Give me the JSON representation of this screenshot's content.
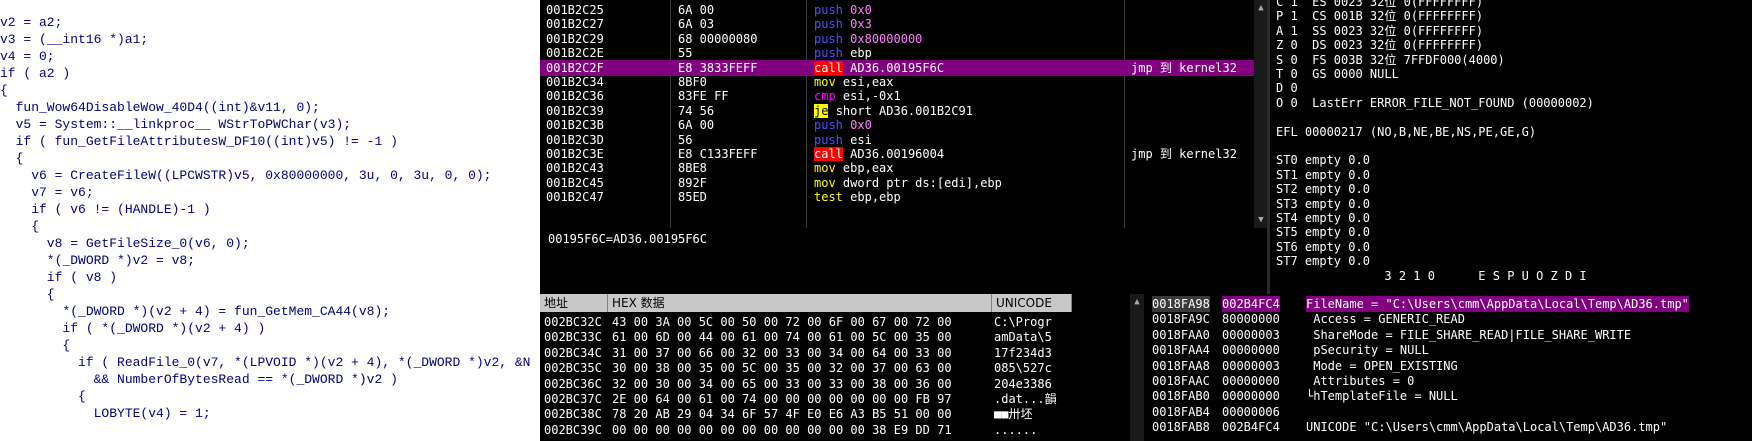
{
  "code": [
    "v2 = a2;",
    "v3 = (__int16 *)a1;",
    "v4 = 0;",
    "if ( a2 )",
    "{",
    "  fun_Wow64DisableWow_40D4((int)&v11, 0);",
    "  v5 = System::__linkproc__ WStrToPWChar(v3);",
    "  if ( fun_GetFileAttributesW_DF10((int)v5) != -1 )",
    "  {",
    "    v6 = CreateFileW((LPCWSTR)v5, 0x80000000, 3u, 0, 3u, 0, 0);",
    "    v7 = v6;",
    "    if ( v6 != (HANDLE)-1 )",
    "    {",
    "      v8 = GetFileSize_0(v6, 0);",
    "      *(_DWORD *)v2 = v8;",
    "      if ( v8 )",
    "      {",
    "        *(_DWORD *)(v2 + 4) = fun_GetMem_CA44(v8);",
    "        if ( *(_DWORD *)(v2 + 4) )",
    "        {",
    "          if ( ReadFile_0(v7, *(LPVOID *)(v2 + 4), *(_DWORD *)v2, &N",
    "            && NumberOfBytesRead == *(_DWORD *)v2 )",
    "          {",
    "            LOBYTE(v4) = 1;"
  ],
  "disasm": [
    {
      "addr": "001B2C25",
      "bytes": "6A 00",
      "mn": "push",
      "ops": "0x0",
      "cmt": ""
    },
    {
      "addr": "001B2C27",
      "bytes": "6A 03",
      "mn": "push",
      "ops": "0x3",
      "cmt": ""
    },
    {
      "addr": "001B2C29",
      "bytes": "68 00000080",
      "mn": "push",
      "ops": "0x80000000",
      "cmt": ""
    },
    {
      "addr": "001B2C2E",
      "bytes": "55",
      "mn": "push",
      "ops": "ebp",
      "cmt": ""
    },
    {
      "addr": "001B2C2F",
      "bytes": "E8 3833FEFF",
      "mn": "call",
      "ops": "AD36.00195F6C",
      "cmt": "jmp 到 kernel32"
    },
    {
      "addr": "001B2C34",
      "bytes": "8BF0",
      "mn": "mov",
      "ops": "esi,eax",
      "cmt": ""
    },
    {
      "addr": "001B2C36",
      "bytes": "83FE FF",
      "mn": "cmp",
      "ops": "esi,-0x1",
      "cmt": ""
    },
    {
      "addr": "001B2C39",
      "bytes": "74 56",
      "mn": "je",
      "ops": "short AD36.001B2C91",
      "cmt": ""
    },
    {
      "addr": "001B2C3B",
      "bytes": "6A 00",
      "mn": "push",
      "ops": "0x0",
      "cmt": ""
    },
    {
      "addr": "001B2C3D",
      "bytes": "56",
      "mn": "push",
      "ops": "esi",
      "cmt": ""
    },
    {
      "addr": "001B2C3E",
      "bytes": "E8 C133FEFF",
      "mn": "call",
      "ops": "AD36.00196004",
      "cmt": "jmp 到 kernel32"
    },
    {
      "addr": "001B2C43",
      "bytes": "8BE8",
      "mn": "mov",
      "ops": "ebp,eax",
      "cmt": ""
    },
    {
      "addr": "001B2C45",
      "bytes": "892F",
      "mn": "mov",
      "ops": "dword ptr ds:[edi],ebp",
      "cmt": ""
    },
    {
      "addr": "001B2C47",
      "bytes": "85ED",
      "mn": "test",
      "ops": "ebp,ebp",
      "cmt": ""
    }
  ],
  "info_line": "00195F6C=AD36.00195F6C",
  "registers": [
    "C 1  ES 0023 32位 0(FFFFFFFF)",
    "P 1  CS 001B 32位 0(FFFFFFFF)",
    "A 1  SS 0023 32位 0(FFFFFFFF)",
    "Z 0  DS 0023 32位 0(FFFFFFFF)",
    "S 0  FS 003B 32位 7FFDF000(4000)",
    "T 0  GS 0000 NULL",
    "D 0",
    "O 0  LastErr ERROR_FILE_NOT_FOUND (00000002)",
    "",
    "EFL 00000217 (NO,B,NE,BE,NS,PE,GE,G)",
    "",
    "ST0 empty 0.0",
    "ST1 empty 0.0",
    "ST2 empty 0.0",
    "ST3 empty 0.0",
    "ST4 empty 0.0",
    "ST5 empty 0.0",
    "ST6 empty 0.0",
    "ST7 empty 0.0",
    "               3 2 1 0      E S P U O Z D I"
  ],
  "hex": {
    "headers": {
      "addr": "地址",
      "hex": "HEX 数据",
      "ascii": "UNICODE"
    },
    "rows": [
      {
        "addr": "002BC32C",
        "bytes": "43 00 3A 00 5C 00 50 00 72 00 6F 00 67 00 72 00",
        "asc": "C:\\Progr"
      },
      {
        "addr": "002BC33C",
        "bytes": "61 00 6D 00 44 00 61 00 74 00 61 00 5C 00 35 00",
        "asc": "amData\\5"
      },
      {
        "addr": "002BC34C",
        "bytes": "31 00 37 00 66 00 32 00 33 00 34 00 64 00 33 00",
        "asc": "17f234d3"
      },
      {
        "addr": "002BC35C",
        "bytes": "30 00 38 00 35 00 5C 00 35 00 32 00 37 00 63 00",
        "asc": "085\\527c"
      },
      {
        "addr": "002BC36C",
        "bytes": "32 00 30 00 34 00 65 00 33 00 33 00 38 00 36 00",
        "asc": "204e3386"
      },
      {
        "addr": "002BC37C",
        "bytes": "2E 00 64 00 61 00 74 00 00 00 00 00 00 00 FB 97",
        "asc": ".dat...韻"
      },
      {
        "addr": "002BC38C",
        "bytes": "78 20 AB 29 04 34 6F 57 4F E0 E6 A3 B5 51 00 00",
        "asc": "■■卅坯"
      },
      {
        "addr": "002BC39C",
        "bytes": "00 00 00 00 00 00 00 00 00 00 00 00 38 E9 DD 71",
        "asc": "......"
      }
    ]
  },
  "stack": [
    {
      "addr": "0018FA98",
      "val": "002B4FC4",
      "cmt": "FileName = \"C:\\Users\\cmm\\AppData\\Local\\Temp\\AD36.tmp\""
    },
    {
      "addr": "0018FA9C",
      "val": "80000000",
      "cmt": " Access = GENERIC_READ"
    },
    {
      "addr": "0018FAA0",
      "val": "00000003",
      "cmt": " ShareMode = FILE_SHARE_READ|FILE_SHARE_WRITE"
    },
    {
      "addr": "0018FAA4",
      "val": "00000000",
      "cmt": " pSecurity = NULL"
    },
    {
      "addr": "0018FAA8",
      "val": "00000003",
      "cmt": " Mode = OPEN_EXISTING"
    },
    {
      "addr": "0018FAAC",
      "val": "00000000",
      "cmt": " Attributes = 0"
    },
    {
      "addr": "0018FAB0",
      "val": "00000000",
      "cmt": "└hTemplateFile = NULL"
    },
    {
      "addr": "0018FAB4",
      "val": "00000006",
      "cmt": ""
    },
    {
      "addr": "0018FAB8",
      "val": "002B4FC4",
      "cmt": "UNICODE \"C:\\Users\\cmm\\AppData\\Local\\Temp\\AD36.tmp\""
    }
  ]
}
